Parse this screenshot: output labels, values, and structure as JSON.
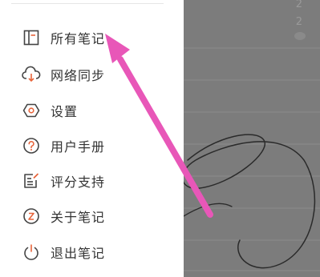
{
  "menu": {
    "items": [
      {
        "label": "所有笔记",
        "icon": "notebook-icon"
      },
      {
        "label": "网络同步",
        "icon": "cloud-sync-icon"
      },
      {
        "label": "设置",
        "icon": "settings-hexagon-icon"
      },
      {
        "label": "用户手册",
        "icon": "help-circle-icon"
      },
      {
        "label": "评分支持",
        "icon": "rate-edit-icon"
      },
      {
        "label": "关于笔记",
        "icon": "about-info-icon"
      },
      {
        "label": "退出笔记",
        "icon": "power-icon"
      }
    ]
  },
  "note_list": {
    "counts": [
      "2",
      "2"
    ]
  },
  "colors": {
    "accent": "#e8643a",
    "icon": "#444444",
    "text": "#333333",
    "overlay": "#7c7c7c",
    "annotation_arrow": "#e857b8"
  }
}
